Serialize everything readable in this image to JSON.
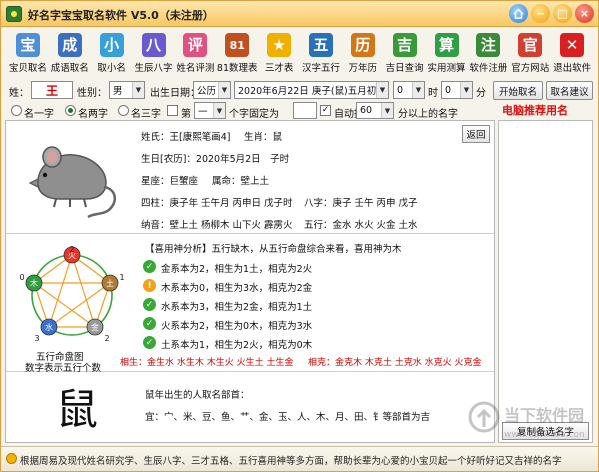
{
  "window": {
    "title": "好名字宝宝取名软件 V5.0（未注册）"
  },
  "titlebar_buttons": {
    "home_icon": "home-icon",
    "minimize_symbol": "−",
    "maximize_symbol": "□",
    "close_symbol": "×"
  },
  "toolbar": [
    {
      "label": "宝贝取名",
      "icon": "baby-icon",
      "color": "#4f8fd8",
      "glyph": "宝"
    },
    {
      "label": "成语取名",
      "icon": "book-icon",
      "color": "#3d6fc0",
      "glyph": "成"
    },
    {
      "label": "取小名",
      "icon": "person-icon",
      "color": "#37a0d8",
      "glyph": "小"
    },
    {
      "label": "生辰八字",
      "icon": "scholar-icon",
      "color": "#6a5acd",
      "glyph": "八"
    },
    {
      "label": "姓名评测",
      "icon": "people-icon",
      "color": "#e05080",
      "glyph": "评"
    },
    {
      "label": "81数理表",
      "icon": "table-icon",
      "color": "#c05020",
      "glyph": "81"
    },
    {
      "label": "三才表",
      "icon": "star-icon",
      "color": "#f0b000",
      "glyph": "★"
    },
    {
      "label": "汉字五行",
      "icon": "gear-person-icon",
      "color": "#2a70b8",
      "glyph": "五"
    },
    {
      "label": "万年历",
      "icon": "calendar-icon",
      "color": "#d07818",
      "glyph": "历"
    },
    {
      "label": "吉日查询",
      "icon": "calendar-check-icon",
      "color": "#3a9a3a",
      "glyph": "吉"
    },
    {
      "label": "实用测算",
      "icon": "calculator-icon",
      "color": "#2f9e44",
      "glyph": "算"
    },
    {
      "label": "软件注册",
      "icon": "lock-icon",
      "color": "#3a8a3a",
      "glyph": "注"
    },
    {
      "label": "官方网站",
      "icon": "house-icon",
      "color": "#d04030",
      "glyph": "官"
    },
    {
      "label": "退出软件",
      "icon": "exit-x-icon",
      "color": "#d82020",
      "glyph": "✕"
    }
  ],
  "form": {
    "surname_label": "姓：",
    "surname_value": "王",
    "gender_label": "性别：",
    "gender_value": "男",
    "birth_label": "出生日期：",
    "calendar_type": "公历",
    "birth_date": "2020年6月22日 庚子(鼠)五月初二",
    "hour_value": "0",
    "hour_unit": "时",
    "minute_value": "0",
    "minute_unit": "分",
    "start_button": "开始取名",
    "suggest_button": "取名建议",
    "radio_one": "名一字",
    "radio_two": "名两字",
    "radio_three": "名三字",
    "position_label": "第",
    "position_value": "一",
    "fixed_char_label": "个字固定为",
    "fixed_char_value": "",
    "auto_filter_label": "自动挑选",
    "auto_filter_value": "60",
    "score_suffix": "分以上的名字"
  },
  "profile": {
    "name_line": "姓氏：王[康熙笔画4]",
    "zodiac_line": "生肖：鼠",
    "lunar_line": "生日[农历]：2020年5月2日　子时",
    "star_line": "星座：巨蟹座",
    "mansion_line": "属命：壁上土",
    "pillars_line": "四柱：庚子年 壬午月 丙申日 戊子时",
    "bazi_line": "八字：庚子 壬午 丙申 戊子",
    "nayin_line": "纳音：壁上土 杨柳木 山下火 霹雳火",
    "wuxing_line": "五行：金水 水火 火金 土水",
    "back_button": "返回"
  },
  "analysis": {
    "header": "【喜用神分析】五行缺木，从五行命盘综合来看，喜用神为木",
    "rows": [
      {
        "icon": "checkmark-icon",
        "status": "ok",
        "text": "金系本为2，相生为1土，相克为2火"
      },
      {
        "icon": "warning-icon",
        "status": "warn",
        "text": "木系本为0，相生为3水，相克为2金"
      },
      {
        "icon": "checkmark-icon",
        "status": "ok",
        "text": "水系本为3，相生为2金，相克为1土"
      },
      {
        "icon": "checkmark-icon",
        "status": "ok",
        "text": "火系本为2，相生为0木，相克为3水"
      },
      {
        "icon": "checkmark-icon",
        "status": "ok",
        "text": "土系本为1，相生为2火，相克为0木"
      }
    ],
    "sheng_line": "相生：金生水 水生木 木生火 火生土 土生金",
    "ke_line": "相克：金克木 木克土 土克水 水克火 火克金",
    "chart_caption_1": "五行命盘图",
    "chart_caption_2": "数字表示五行个数",
    "wheel": [
      {
        "name": "火",
        "count": "2",
        "color": "#e8372a"
      },
      {
        "name": "土",
        "count": "1",
        "color": "#b07b30"
      },
      {
        "name": "金",
        "count": "2",
        "color": "#9a9a9a"
      },
      {
        "name": "水",
        "count": "3",
        "color": "#3b6fd0"
      },
      {
        "name": "木",
        "count": "0",
        "color": "#2e9e3e"
      }
    ]
  },
  "zodiac_advice": {
    "char": "鼠",
    "title": "鼠年出生的人取名部首：",
    "radicals": "宜：宀、米、豆、鱼、艹、金、玉、人、木、月、田、钅等部首为吉"
  },
  "recommend": {
    "title": "电脑推荐用名",
    "copy_button": "复制备选名字"
  },
  "status": {
    "text": "根据周易及现代姓名研究学、生辰八字、三才五格、五行喜用神等多方面，帮助长辈为心爱的小宝贝起一个好听好记又吉祥的名字"
  },
  "watermark": {
    "brand": "当下软件园",
    "url": "www.downxia.com"
  }
}
